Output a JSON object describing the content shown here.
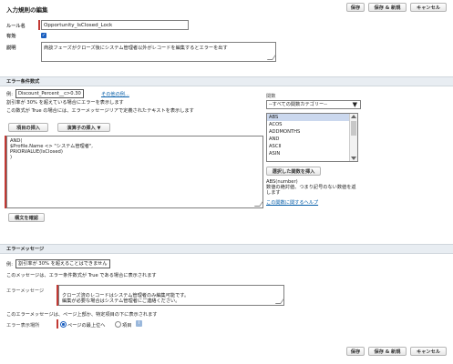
{
  "header": {
    "title": "入力規則の編集",
    "buttons": [
      "保存",
      "保存 & 新規",
      "キャンセル"
    ]
  },
  "rule": {
    "name_label": "ルール名",
    "name_value": "Opportunity_IsClosed_Lock",
    "active_label": "有効",
    "description_label": "説明",
    "description_value": "商談フェーズがクローズ後にシステム管理者以外がレコードを編集するとエラーを出す"
  },
  "condition": {
    "section_title": "エラー条件数式",
    "example_prefix": "例:",
    "example_formula": "Discount_Percent__c>0.30",
    "example_link": "その他の例...",
    "example_desc1": "割引率が 30% を超えている場合にエラーを表示します",
    "example_desc2": "この数式が True の場合には、エラーメッセージリアで定義されたテキストを表示します",
    "insert_field_button": "項目の挿入",
    "insert_operator_button": "演算子の挿入 ▼",
    "formula_lines": [
      "AND(",
      " $Profile.Name <> \"システム管理者\",",
      " PRIORVALUE(IsClosed)",
      ")"
    ],
    "check_syntax_button": "構文を確認"
  },
  "functions": {
    "label": "関数",
    "category_selected": "--すべての関数カテゴリー--",
    "items": [
      "ABS",
      "ACOS",
      "ADDMONTHS",
      "AND",
      "ASCII",
      "ASIN"
    ],
    "selected_index": 0,
    "insert_button": "選択した関数を挿入",
    "signature": "ABS(number)",
    "description": "数値の絶対値、つまり記号のない数値を返します",
    "help_link": "この関数に関するヘルプ"
  },
  "error_message": {
    "section_title": "エラーメッセージ",
    "example_prefix": "例:",
    "example_text": "割引率が 30% を超えることはできません",
    "example_desc": "このメッセージは、エラー条件数式が True である場合に表示されます",
    "message_label": "エラーメッセージ",
    "message_value": "クローズ済のレコードはシステム管理者のみ編集可能です。\n編集が必要な場合はシステム管理者にご連絡ください。",
    "location_desc": "このエラーメッセージは、ページ上部か、特定項目の下に表示されます",
    "location_label": "エラー表示場所",
    "location_options": [
      "ページの最上位へ",
      "項目"
    ],
    "location_selected": 0,
    "info_icon_text": "i"
  },
  "footer": {
    "buttons": [
      "保存",
      "保存 & 新規",
      "キャンセル"
    ]
  },
  "colors": {
    "required": "#c23934",
    "section_bg": "#e8edf2",
    "link": "#015ba7",
    "radio": "#1b5fbf"
  }
}
